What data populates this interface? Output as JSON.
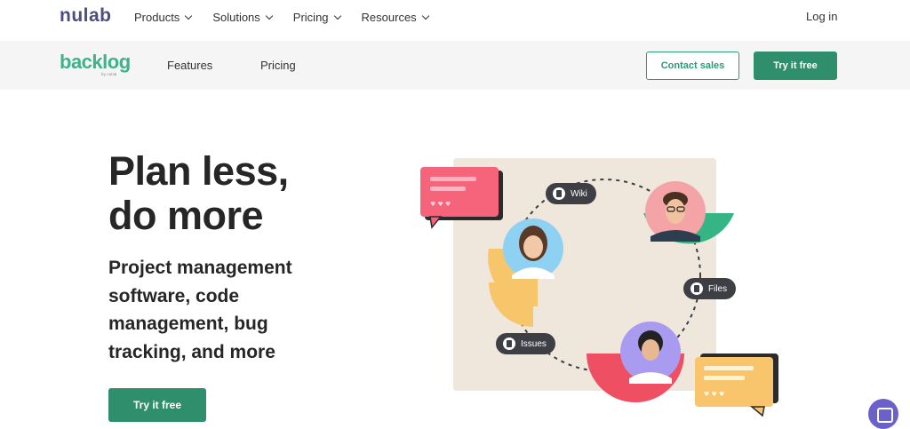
{
  "topbar": {
    "logo": "nulab",
    "nav": [
      {
        "label": "Products"
      },
      {
        "label": "Solutions"
      },
      {
        "label": "Pricing"
      },
      {
        "label": "Resources"
      }
    ],
    "login": "Log in"
  },
  "subbar": {
    "logo": "backlog",
    "logo_by": "by nulab",
    "nav": [
      {
        "label": "Features"
      },
      {
        "label": "Pricing"
      }
    ],
    "contact_label": "Contact sales",
    "try_label": "Try it free"
  },
  "hero": {
    "title_line1": "Plan less,",
    "title_line2": "do more",
    "subtitle": "Project management software, code management, bug tracking, and more",
    "cta": "Try it free"
  },
  "illustration": {
    "pills": [
      {
        "label": "Wiki",
        "icon": "wiki-icon"
      },
      {
        "label": "Files",
        "icon": "files-icon"
      },
      {
        "label": "Issues",
        "icon": "issues-icon"
      }
    ]
  },
  "colors": {
    "brand_green": "#2f8f6d",
    "backlog_green": "#3cb389",
    "nulab_navy": "#4b4f80",
    "chat_purple": "#6b62c9"
  }
}
